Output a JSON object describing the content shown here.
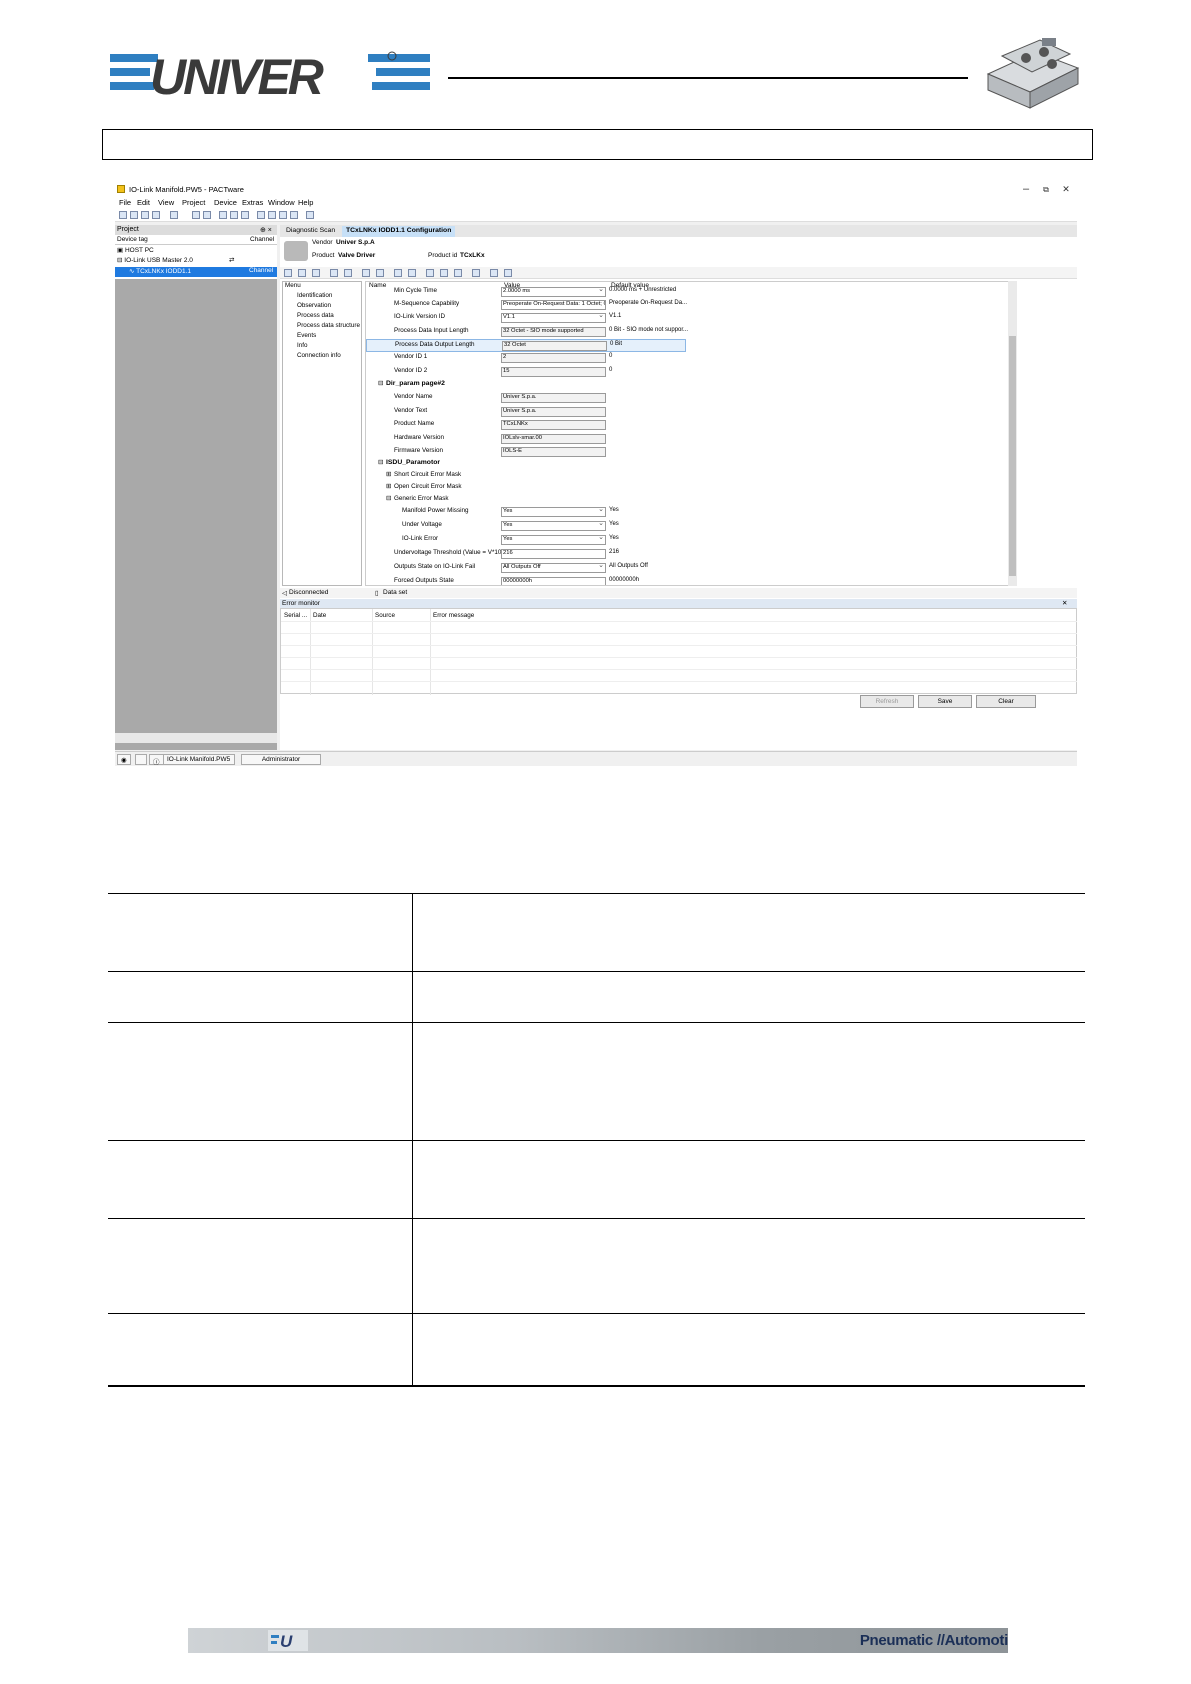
{
  "header": {
    "logo_text": "UNIVER"
  },
  "window": {
    "title": "IO-Link Manifold.PW5 - PACTware",
    "controls": [
      "–",
      "⧉",
      "✕"
    ],
    "menu": [
      "File",
      "Edit",
      "View",
      "Project",
      "Device",
      "Extras",
      "Window",
      "Help"
    ]
  },
  "project_pane": {
    "title": "Project",
    "pin": "⊕ ×",
    "col_device_tag": "Device tag",
    "col_channel": "Channel",
    "tree": [
      {
        "label": "HOST PC"
      },
      {
        "label": "IO-Link USB Master 2.0"
      },
      {
        "label": "TCxLNKx IODD1.1",
        "channel": "Channel"
      }
    ]
  },
  "tabs": [
    {
      "label": "Diagnostic Scan"
    },
    {
      "label": "TCxLNKx IODD1.1 Configuration"
    }
  ],
  "device_info": {
    "vendor_label": "Vendor",
    "vendor": "Univer S.p.A",
    "product_label": "Product",
    "product": "Valve Driver",
    "product_id_label": "Product id",
    "product_id": "TCxLKx"
  },
  "menu_pane": {
    "title": "Menu",
    "items": [
      "Identification",
      "Observation",
      "Process data",
      "Process data structure",
      "Events",
      "Info",
      "Connection info"
    ]
  },
  "grid": {
    "col_name": "Name",
    "col_value": "Value",
    "col_default": "Default value",
    "rows": [
      {
        "name": "Min Cycle Time",
        "value": "2.0000 ms",
        "default": "0.0000 ms + Unrestricted"
      },
      {
        "name": "M-Sequence Capability",
        "value": "Preoperate On-Request Data: 1 Octet; O",
        "default": "Preoperate On-Request Da..."
      },
      {
        "name": "IO-Link Version ID",
        "value": "V1.1",
        "default": "V1.1"
      },
      {
        "name": "Process Data Input Length",
        "value": "32 Octet - SIO mode supported",
        "default": "0 Bit - SIO mode not suppor..."
      },
      {
        "name": "Process Data Output Length",
        "value": "32 Octet",
        "default": "0 Bit"
      },
      {
        "name": "Vendor ID 1",
        "value": "2",
        "default": "0"
      },
      {
        "name": "Vendor ID 2",
        "value": "15",
        "default": "0"
      },
      {
        "group": "Dir_param page#2"
      },
      {
        "name": "Vendor Name",
        "value": "Univer S.p.a.",
        "default": ""
      },
      {
        "name": "Vendor Text",
        "value": "Univer S.p.a.",
        "default": ""
      },
      {
        "name": "Product Name",
        "value": "TCxLNKx",
        "default": ""
      },
      {
        "name": "Hardware Version",
        "value": "IOLslv-smar.00",
        "default": ""
      },
      {
        "name": "Firmware Version",
        "value": "IOLS-E",
        "default": ""
      },
      {
        "group": "ISDU_Paramotor"
      },
      {
        "name": "Short Circuit Error Mask"
      },
      {
        "name": "Open Circuit Error Mask"
      },
      {
        "name": "Generic Error Mask"
      },
      {
        "name": "Manifold Power Missing",
        "value": "Yes",
        "default": "Yes"
      },
      {
        "name": "Under Voltage",
        "value": "Yes",
        "default": "Yes"
      },
      {
        "name": "IO-Link Error",
        "value": "Yes",
        "default": "Yes"
      },
      {
        "name": "Undervoltage Threshold (Value = V*10)",
        "value": "216",
        "default": "216"
      },
      {
        "name": "Outputs State on IO-Link Fail",
        "value": "All Outputs Off",
        "default": "All Outputs Off"
      },
      {
        "name": "Forced Outputs State",
        "value": "00000000h",
        "default": "00000000h"
      }
    ]
  },
  "status": {
    "connection": "Disconnected",
    "dataset": "Data set"
  },
  "error_monitor": {
    "title": "Error monitor",
    "columns": [
      "Serial ...",
      "Date",
      "Source",
      "Error message"
    ]
  },
  "buttons": {
    "refresh": "Refresh",
    "save": "Save",
    "clear": "Clear"
  },
  "bottom_bar": {
    "project_file": "IO-Link Manifold.PW5",
    "user": "Administrator"
  },
  "footer": {
    "text": "Pneumatic //Automoti"
  }
}
